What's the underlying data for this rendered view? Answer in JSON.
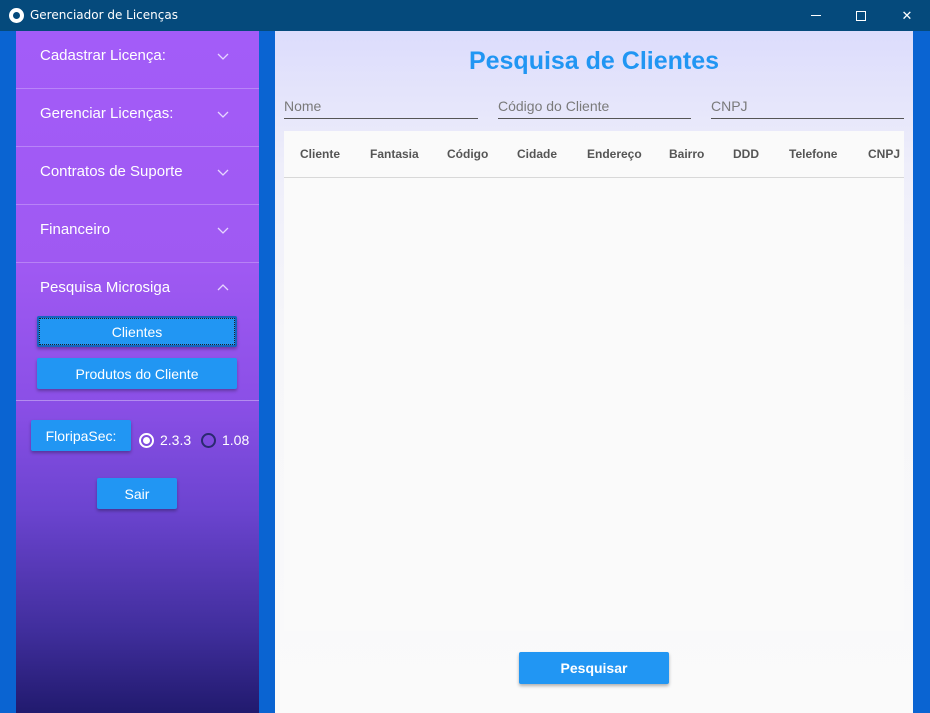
{
  "window": {
    "title": "Gerenciador de Licenças",
    "minimize_glyph": "",
    "maximize_glyph": "",
    "close_glyph": "✕"
  },
  "sidebar": {
    "items": [
      {
        "label": "Cadastrar Licença:",
        "expanded": false
      },
      {
        "label": "Gerenciar Licenças:",
        "expanded": false
      },
      {
        "label": "Contratos de Suporte",
        "expanded": false
      },
      {
        "label": "Financeiro",
        "expanded": false
      },
      {
        "label": "Pesquisa Microsiga",
        "expanded": true
      }
    ],
    "sub_buttons": {
      "clientes": "Clientes",
      "produtos": "Produtos do Cliente"
    },
    "floripasec_label": "FloripaSec:",
    "radio_options": [
      {
        "label": "2.3.3",
        "checked": true
      },
      {
        "label": "1.08",
        "checked": false
      }
    ],
    "exit_label": "Sair"
  },
  "main": {
    "title": "Pesquisa de Clientes",
    "fields": {
      "nome": {
        "placeholder": "Nome",
        "value": ""
      },
      "codigo": {
        "placeholder": "Código do Cliente",
        "value": ""
      },
      "cnpj": {
        "placeholder": "CNPJ",
        "value": ""
      }
    },
    "table_headers": [
      "Cliente",
      "Fantasia",
      "Código",
      "Cidade",
      "Endereço",
      "Bairro",
      "DDD",
      "Telefone",
      "CNPJ"
    ],
    "table_rows": [],
    "search_label": "Pesquisar"
  },
  "colors": {
    "accent": "#2196f3",
    "titlebar": "#054a7c",
    "frame": "#0a64d2",
    "sidebar_top": "#a35cf8",
    "sidebar_bottom": "#211a6e"
  }
}
